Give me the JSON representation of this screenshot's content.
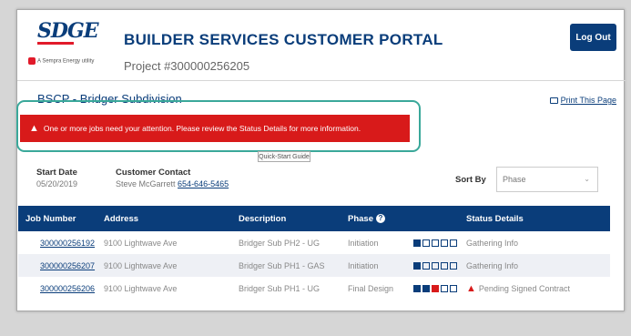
{
  "header": {
    "logo_text": "SDGE",
    "logo_tagline": "A Sempra Energy utility",
    "title": "BUILDER SERVICES CUSTOMER PORTAL",
    "project": "Project #300000256205",
    "logout_label": "Log Out"
  },
  "page": {
    "subtitle": "BSCP - Bridger Subdivision",
    "print_label": "Print This Page"
  },
  "alert": {
    "message": "One or more jobs need your attention. Please review the Status Details for more information."
  },
  "quickstart_label": "Quick-Start Guide",
  "start_date": {
    "label": "Start Date",
    "value": "05/20/2019"
  },
  "customer_contact": {
    "label": "Customer Contact",
    "name": "Steve McGarrett",
    "phone": "654-646-5465"
  },
  "sort": {
    "label": "Sort By",
    "selected": "Phase"
  },
  "table": {
    "headers": [
      "Job Number",
      "Address",
      "Description",
      "Phase",
      "Status Details"
    ],
    "rows": [
      {
        "job": "300000256192",
        "address": "9100 Lightwave Ave",
        "description": "Bridger Sub PH2 - UG",
        "phase": "Initiation",
        "progress": 1,
        "progress_red": 0,
        "status": "Gathering Info",
        "warning": false
      },
      {
        "job": "300000256207",
        "address": "9100 Lightwave Ave",
        "description": "Bridger Sub PH1 - GAS",
        "phase": "Initiation",
        "progress": 1,
        "progress_red": 0,
        "status": "Gathering Info",
        "warning": false
      },
      {
        "job": "300000256206",
        "address": "9100 Lightwave Ave",
        "description": "Bridger Sub PH1 - UG",
        "phase": "Final Design",
        "progress": 3,
        "progress_red": 1,
        "status": "Pending Signed Contract",
        "warning": true
      }
    ]
  },
  "colors": {
    "brand": "#0a3d7a",
    "alert": "#d81a1a",
    "highlight": "#3aa89a"
  }
}
